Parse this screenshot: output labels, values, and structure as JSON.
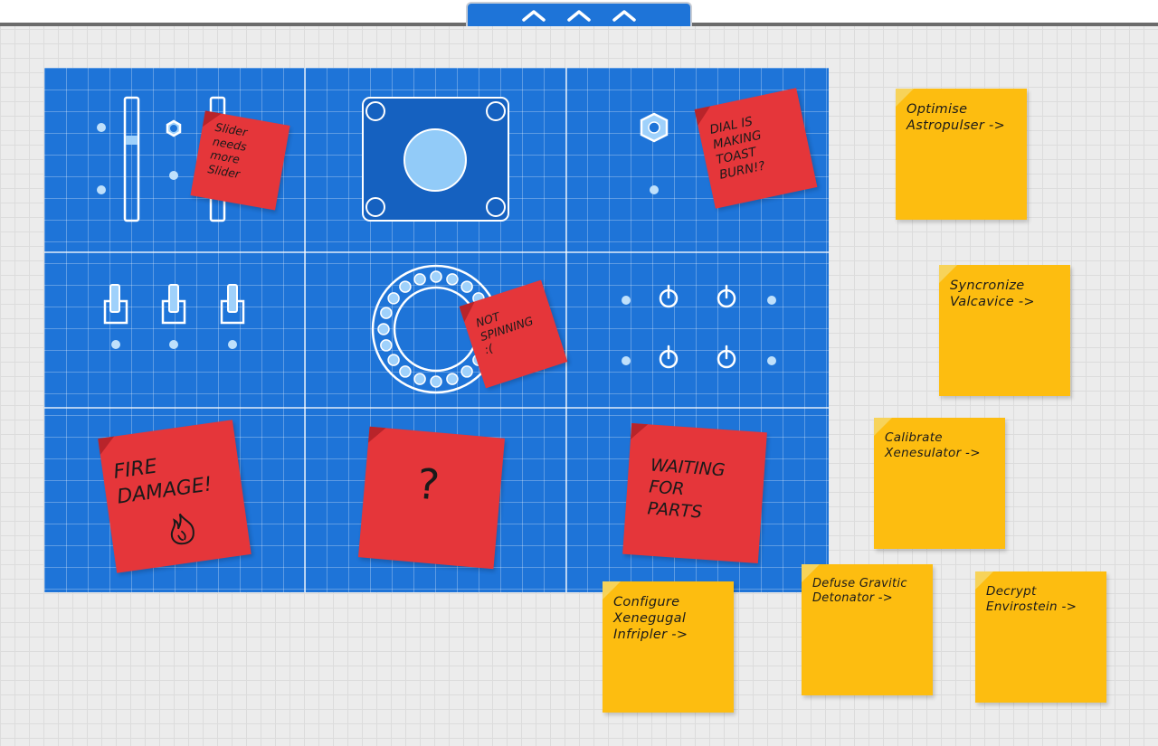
{
  "toolbar": {
    "collapse_icon": "chevron-up-icon",
    "chevron_count": 3,
    "accent": "#1e74d8"
  },
  "board": {
    "color": "#1e74d8",
    "red_notes": [
      {
        "id": "slider",
        "text": "Slider\nneeds\nmore\nSlider"
      },
      {
        "id": "dial",
        "text": "DIAL IS\nMAKING\nTOAST\nBURN!?"
      },
      {
        "id": "spin",
        "text": "NOT\nSPINNING\n:("
      },
      {
        "id": "fire",
        "text": "FIRE\nDAMAGE!"
      },
      {
        "id": "question",
        "text": "?"
      },
      {
        "id": "waiting",
        "text": "WAITING\nFOR\nPARTS"
      }
    ]
  },
  "tasks": [
    {
      "id": "optimise",
      "text": "Optimise\nAstropulser ->"
    },
    {
      "id": "syncronize",
      "text": "Syncronize\nValcavice ->"
    },
    {
      "id": "calibrate",
      "text": "Calibrate\nXenesulator ->"
    },
    {
      "id": "configure",
      "text": "Configure\nXenegugal\nInfripler ->"
    },
    {
      "id": "defuse",
      "text": "Defuse Gravitic\nDetonator ->"
    },
    {
      "id": "decrypt",
      "text": "Decrypt\nEnvirostein ->"
    }
  ],
  "colors": {
    "note_yellow": "#fdbd10",
    "note_red": "#e5363a",
    "background": "#ececec"
  }
}
